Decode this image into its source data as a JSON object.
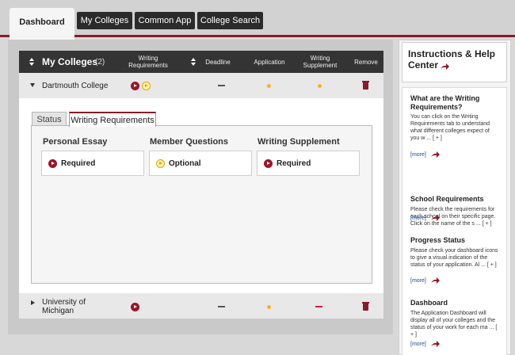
{
  "nav": {
    "tabs": [
      {
        "label": "Dashboard",
        "active": true
      },
      {
        "label": "My Colleges"
      },
      {
        "label": "Common App"
      },
      {
        "label": "College Search"
      }
    ]
  },
  "table": {
    "title": "My Colleges",
    "count": "(2)",
    "columns": {
      "writing_requirements": "Writing Requirements",
      "deadline": "Deadline",
      "application": "Application",
      "writing_supplement": "Writing Supplement",
      "remove": "Remove"
    },
    "rows": [
      {
        "college": "Dartmouth College",
        "expanded": true
      },
      {
        "college": "University of Michigan",
        "expanded": false
      }
    ]
  },
  "detail": {
    "tabs": [
      "Status",
      "Writing Requirements"
    ],
    "active_tab": "Writing Requirements",
    "columns": [
      {
        "heading": "Personal Essay",
        "status": "Required"
      },
      {
        "heading": "Member Questions",
        "status": "Optional"
      },
      {
        "heading": "Writing Supplement",
        "status": "Required"
      }
    ]
  },
  "help": {
    "title": "Instructions & Help Center",
    "more_label": "[more]",
    "sections": [
      {
        "title": "What are the Writing Requirements?",
        "text": "You can click on the Writing Requirements tab to understand what different colleges expect of you w ... [ + ]"
      },
      {
        "title": "School Requirements",
        "text": "Please check the requirements for each school on their specific page. Click on the name of the s ... [ + ]"
      },
      {
        "title": "Progress Status",
        "text": "Please check your dashboard icons to give a visual indication of the status of your application. Al ... [ + ]"
      },
      {
        "title": "Dashboard",
        "text": "The Application Dashboard will display all of your colleges and the status of your work for each ma ... [ + ]"
      }
    ]
  },
  "colors": {
    "accent": "#8a1a2c",
    "header_bg": "#343434",
    "optional_yellow": "#f0b429",
    "link": "#1a4a8a"
  }
}
